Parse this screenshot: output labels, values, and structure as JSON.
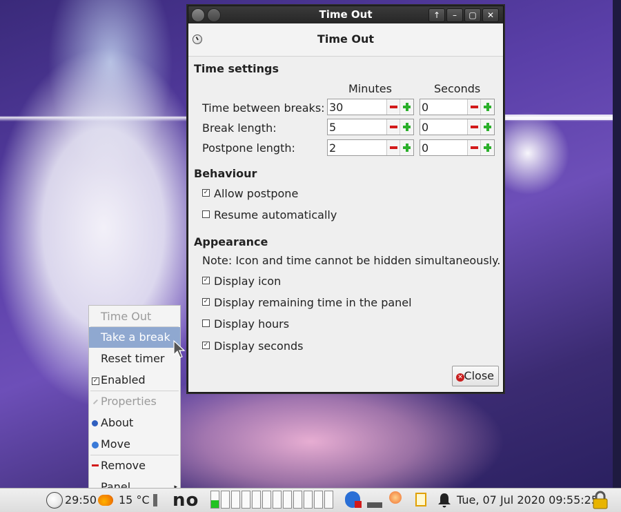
{
  "window": {
    "title": "Time Out",
    "header_title": "Time Out"
  },
  "time_settings": {
    "title": "Time settings",
    "col_minutes": "Minutes",
    "col_seconds": "Seconds",
    "rows": [
      {
        "label": "Time between breaks:",
        "minutes": "30",
        "seconds": "0"
      },
      {
        "label": "Break length:",
        "minutes": "5",
        "seconds": "0"
      },
      {
        "label": "Postpone length:",
        "minutes": "2",
        "seconds": "0"
      }
    ]
  },
  "behaviour": {
    "title": "Behaviour",
    "allow_postpone": {
      "label": "Allow postpone",
      "checked": true
    },
    "resume_automatically": {
      "label": "Resume automatically",
      "checked": false
    }
  },
  "appearance": {
    "title": "Appearance",
    "note": "Note: Icon and time cannot be hidden simultaneously.",
    "display_icon": {
      "label": "Display icon",
      "checked": true
    },
    "display_remaining_time": {
      "label": "Display remaining time in the panel",
      "checked": true
    },
    "display_hours": {
      "label": "Display hours",
      "checked": false
    },
    "display_seconds": {
      "label": "Display seconds",
      "checked": true
    }
  },
  "close_label": "Close",
  "context_menu": {
    "title": "Time Out",
    "take_break": "Take a break",
    "reset_timer": "Reset timer",
    "enabled": "Enabled",
    "properties": "Properties",
    "about": "About",
    "move": "Move",
    "remove": "Remove",
    "panel": "Panel"
  },
  "taskbar": {
    "timer": "29:50",
    "weather": "15 °C",
    "cpu_label": "no",
    "datetime": "Tue, 07 Jul 2020 09:55:25"
  }
}
